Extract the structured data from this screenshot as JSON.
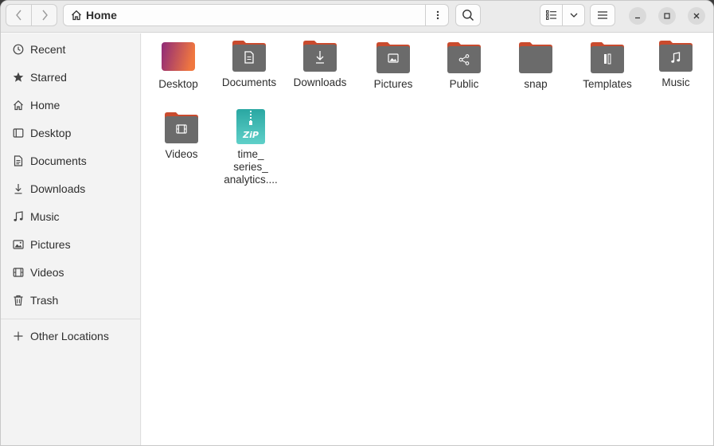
{
  "headerbar": {
    "path_label": "Home",
    "icons": [
      "back-icon",
      "forward-icon",
      "home-icon",
      "kebab-menu-icon",
      "search-icon",
      "list-view-icon",
      "chevron-down-icon",
      "hamburger-menu-icon",
      "minimize-icon",
      "maximize-icon",
      "close-icon"
    ]
  },
  "sidebar": {
    "items": [
      {
        "label": "Recent",
        "icon": "clock-icon"
      },
      {
        "label": "Starred",
        "icon": "star-icon"
      },
      {
        "label": "Home",
        "icon": "home-icon"
      },
      {
        "label": "Desktop",
        "icon": "desktop-icon"
      },
      {
        "label": "Documents",
        "icon": "document-icon"
      },
      {
        "label": "Downloads",
        "icon": "download-icon"
      },
      {
        "label": "Music",
        "icon": "music-icon"
      },
      {
        "label": "Pictures",
        "icon": "picture-icon"
      },
      {
        "label": "Videos",
        "icon": "video-icon"
      },
      {
        "label": "Trash",
        "icon": "trash-icon"
      }
    ],
    "other_locations": "Other Locations"
  },
  "files": [
    {
      "name": "Desktop",
      "type": "desktop-folder"
    },
    {
      "name": "Documents",
      "type": "folder"
    },
    {
      "name": "Downloads",
      "type": "folder"
    },
    {
      "name": "Pictures",
      "type": "folder"
    },
    {
      "name": "Public",
      "type": "folder"
    },
    {
      "name": "snap",
      "type": "folder"
    },
    {
      "name": "Templates",
      "type": "folder"
    },
    {
      "name": "Music",
      "type": "folder"
    },
    {
      "name": "Videos",
      "type": "folder"
    },
    {
      "name_lines": [
        "time_",
        "series_",
        "analytics...."
      ],
      "type": "zip"
    }
  ],
  "colors": {
    "folder_body": "#6b6b6b",
    "folder_tab": "#c94b2e",
    "zip_teal": "#3cb8b3",
    "desktop_gradient_start": "#8f2a78",
    "desktop_gradient_end": "#f0773f"
  },
  "zip_badge": "ZiP"
}
